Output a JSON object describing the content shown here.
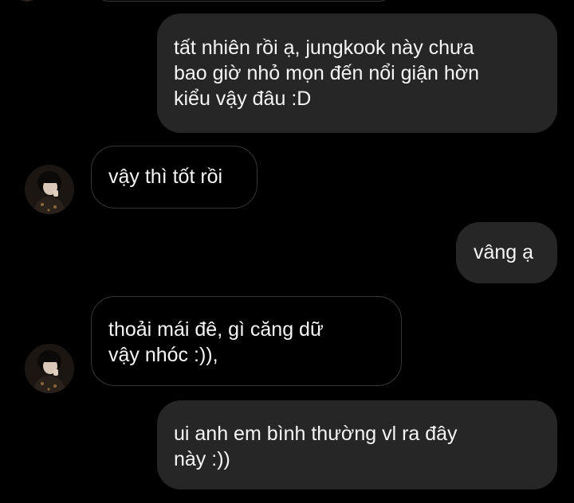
{
  "conversation": {
    "messages": [
      {
        "direction": "sent",
        "text": "tất nhiên rồi ạ, jungkook này chưa\nbao giờ nhỏ mọn đến nổi giận hờn\nkiểu vậy đâu :D"
      },
      {
        "direction": "received",
        "text": "vậy thì tốt rồi"
      },
      {
        "direction": "sent",
        "text": "vâng ạ"
      },
      {
        "direction": "received",
        "text": "thoải mái đê, gì căng dữ\nvậy nhóc :)),"
      },
      {
        "direction": "sent",
        "text": "ui anh em bình thường vl ra đây\nnày :))"
      }
    ]
  },
  "colors": {
    "background": "#000000",
    "sent_bubble": "#262626",
    "received_border": "#363636",
    "text": "#f5f5f5"
  },
  "icons": {
    "avatar": "contact-avatar-photo"
  }
}
